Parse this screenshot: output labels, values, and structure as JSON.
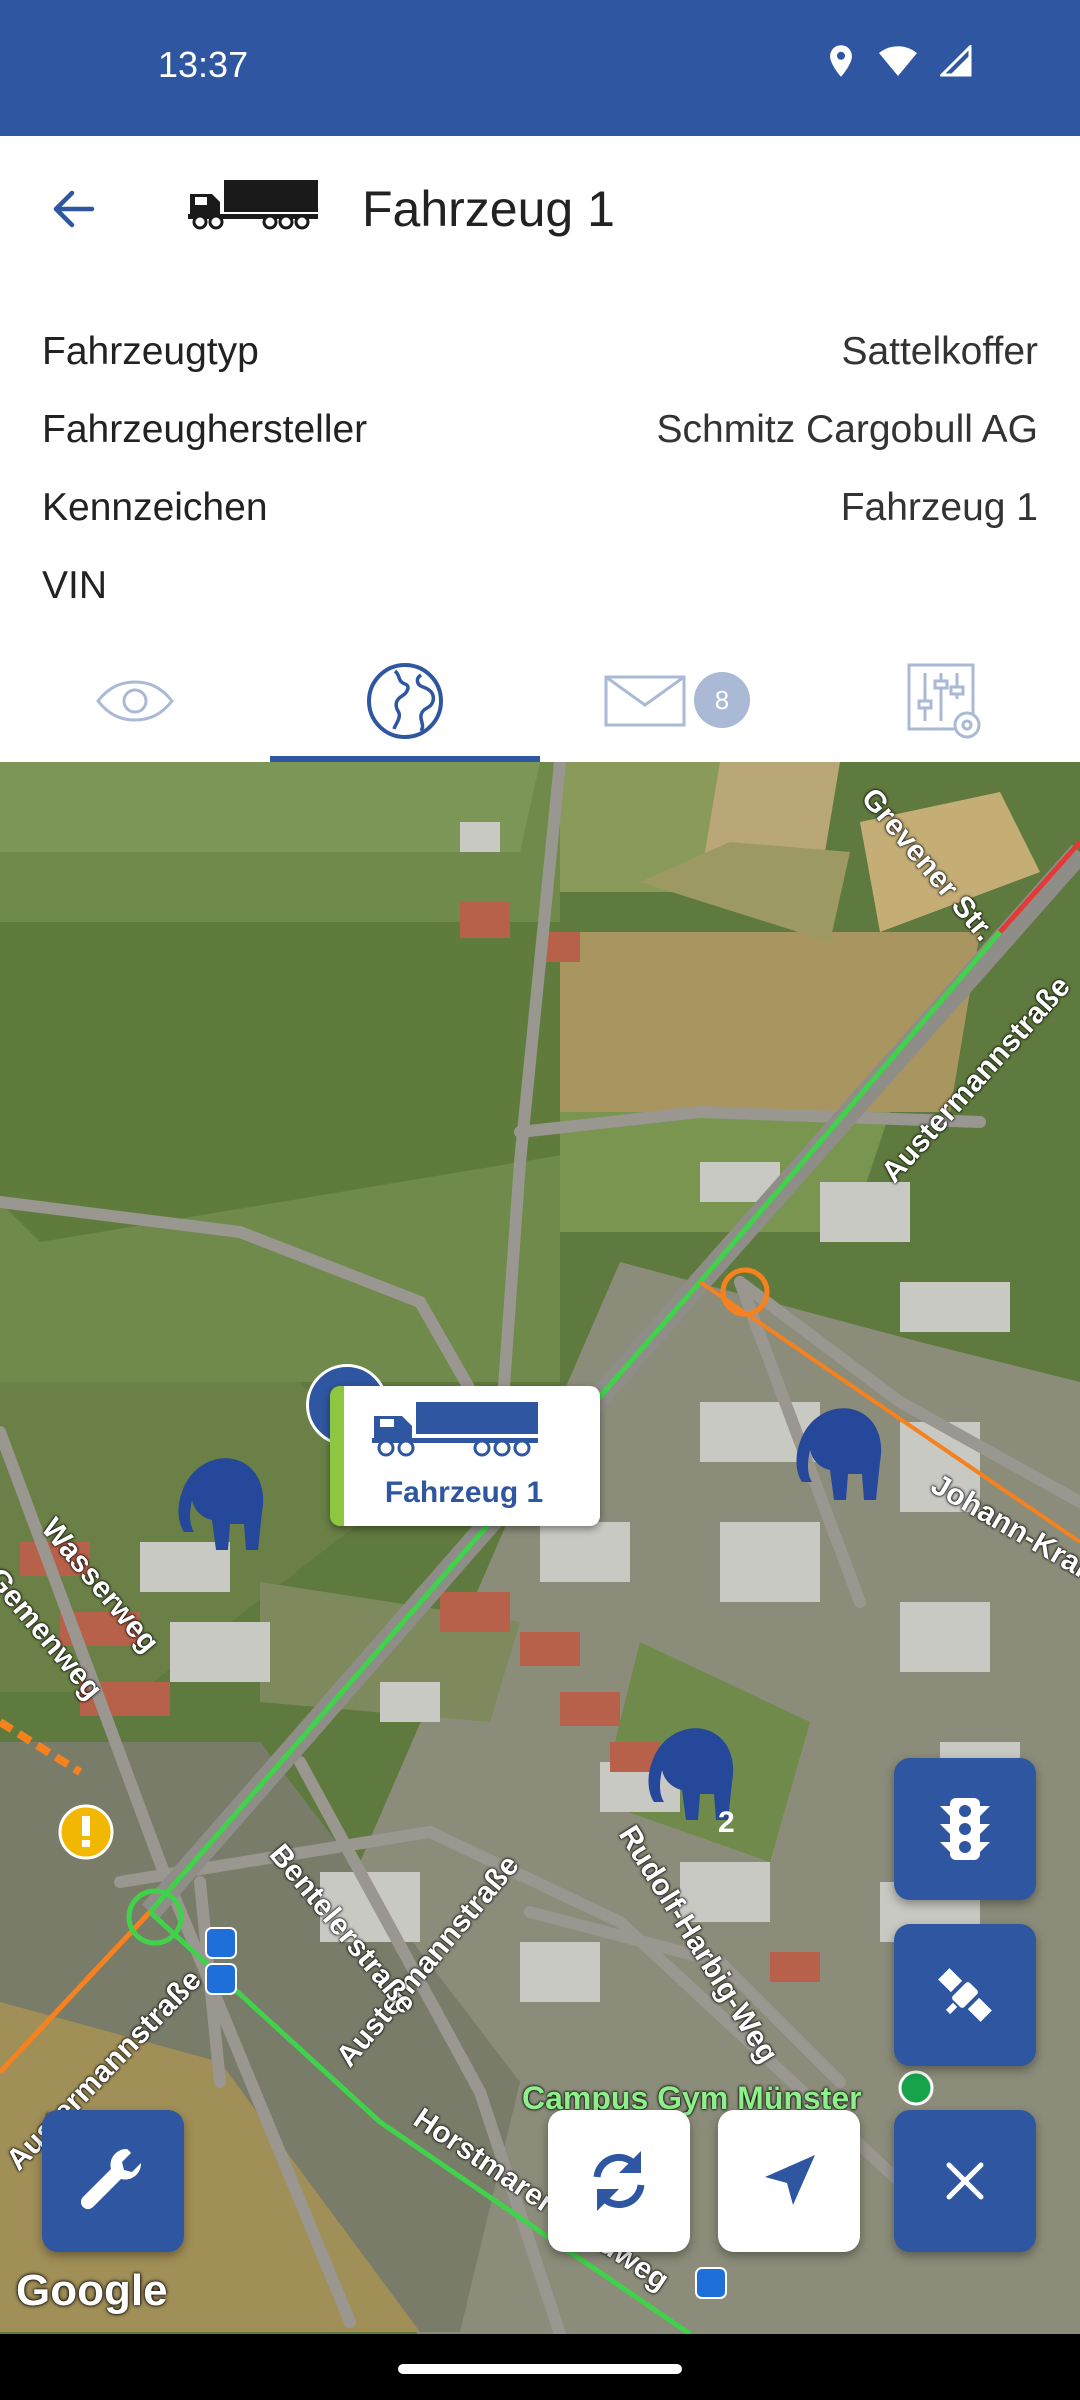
{
  "status_bar": {
    "time": "13:37",
    "icons": [
      "location-icon",
      "wifi-icon",
      "signal-icon"
    ]
  },
  "header": {
    "back_icon": "arrow-left-icon",
    "vehicle_icon": "truck-icon",
    "title": "Fahrzeug 1"
  },
  "details": {
    "rows": [
      {
        "label": "Fahrzeugtyp",
        "value": "Sattelkoffer"
      },
      {
        "label": "Fahrzeughersteller",
        "value": "Schmitz Cargobull AG"
      },
      {
        "label": "Kennzeichen",
        "value": "Fahrzeug 1"
      },
      {
        "label": "VIN",
        "value": ""
      }
    ]
  },
  "tabs": {
    "items": [
      {
        "icon": "eye-icon",
        "selected": false
      },
      {
        "icon": "globe-icon",
        "selected": true
      },
      {
        "icon": "mail-icon",
        "selected": false,
        "badge": "8"
      },
      {
        "icon": "settings-sliders-icon",
        "selected": false
      }
    ]
  },
  "map": {
    "vehicle_marker_label": "Fahrzeug 1",
    "cluster_count": "2",
    "street_labels": [
      "Austermannstraße",
      "Austermannstraße",
      "Rudolf-Harbig-Weg",
      "Bentelerstraße",
      "Horstmarer Landweg",
      "Wasserweg",
      "Gemenweg",
      "Johann-Krane-Weg",
      "Campus Gym Münster",
      "Grevener Str.",
      "Austermannstraße"
    ],
    "attribution": "Google",
    "colors": {
      "accent": "#2f56a0",
      "traffic_green": "#3fd24a",
      "traffic_orange": "#f5821f",
      "traffic_red": "#e53935"
    }
  },
  "controls": {
    "traffic_button_icon": "traffic-light-icon",
    "satellite_button_icon": "satellite-icon",
    "close_button_icon": "close-icon",
    "tools_button_icon": "wrench-icon",
    "refresh_button_icon": "refresh-icon",
    "locate_button_icon": "navigation-arrow-icon"
  }
}
